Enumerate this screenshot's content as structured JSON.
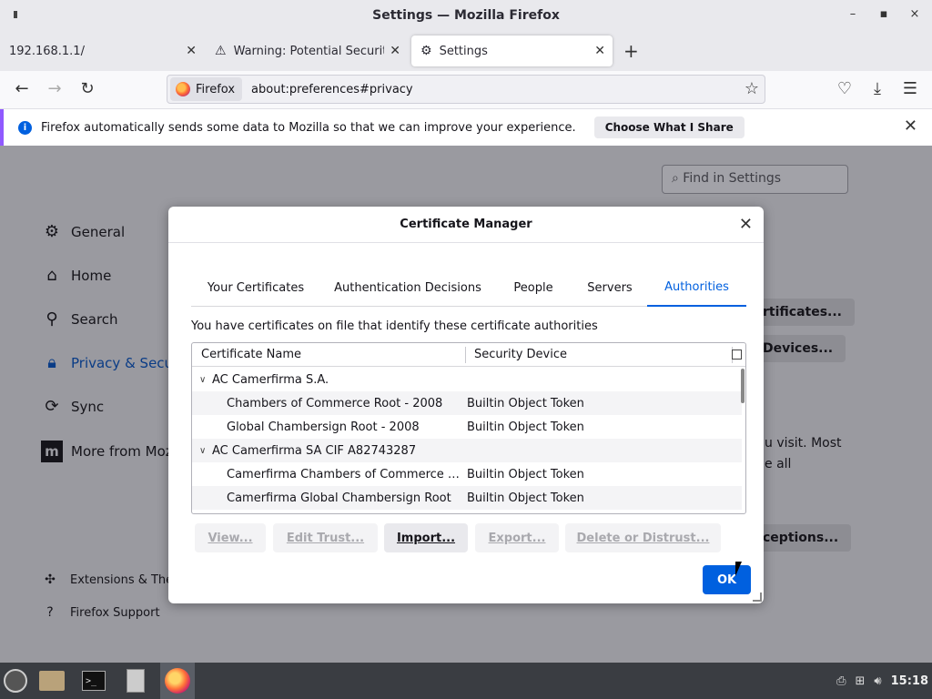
{
  "window": {
    "title": "Settings — Mozilla Firefox"
  },
  "tabs": [
    {
      "label": "192.168.1.1/"
    },
    {
      "label": "Warning: Potential Security"
    },
    {
      "label": "Settings"
    }
  ],
  "urlbar": {
    "identity": "Firefox",
    "url": "about:preferences#privacy"
  },
  "notification": {
    "text": "Firefox automatically sends some data to Mozilla so that we can improve your experience.",
    "button": "Choose What I Share"
  },
  "settings": {
    "find_placeholder": "Find in Settings",
    "sidebar": [
      {
        "label": "General"
      },
      {
        "label": "Home"
      },
      {
        "label": "Search"
      },
      {
        "label": "Privacy & Secu"
      },
      {
        "label": "Sync"
      },
      {
        "label": "More from Moz"
      }
    ],
    "sidebar_footer": [
      {
        "label": "Extensions & Ther"
      },
      {
        "label": "Firefox Support"
      }
    ],
    "background": {
      "view_certs": "rtificates...",
      "security_devices": "Devices...",
      "text_line1": "u visit. Most",
      "text_line2": "e all",
      "exceptions": "ceptions..."
    }
  },
  "dialog": {
    "title": "Certificate Manager",
    "tabs": [
      {
        "label": "Your Certificates"
      },
      {
        "label": "Authentication Decisions"
      },
      {
        "label": "People"
      },
      {
        "label": "Servers"
      },
      {
        "label": "Authorities"
      }
    ],
    "description": "You have certificates on file that identify these certificate authorities",
    "columns": {
      "name": "Certificate Name",
      "device": "Security Device"
    },
    "rows": [
      {
        "group": "AC Camerfirma S.A."
      },
      {
        "name": "Chambers of Commerce Root - 2008",
        "device": "Builtin Object Token"
      },
      {
        "name": "Global Chambersign Root - 2008",
        "device": "Builtin Object Token"
      },
      {
        "group": "AC Camerfirma SA CIF A82743287"
      },
      {
        "name": "Camerfirma Chambers of Commerce R...",
        "device": "Builtin Object Token"
      },
      {
        "name": "Camerfirma Global Chambersign Root",
        "device": "Builtin Object Token"
      }
    ],
    "buttons": {
      "view": "View...",
      "edit_trust": "Edit Trust...",
      "import": "Import...",
      "export": "Export...",
      "delete": "Delete or Distrust...",
      "ok": "OK"
    }
  },
  "taskbar": {
    "clock": "15:18",
    "terminal_glyph": ">_"
  },
  "colors": {
    "accent": "#0060df",
    "notification_border": "#9059ff"
  }
}
